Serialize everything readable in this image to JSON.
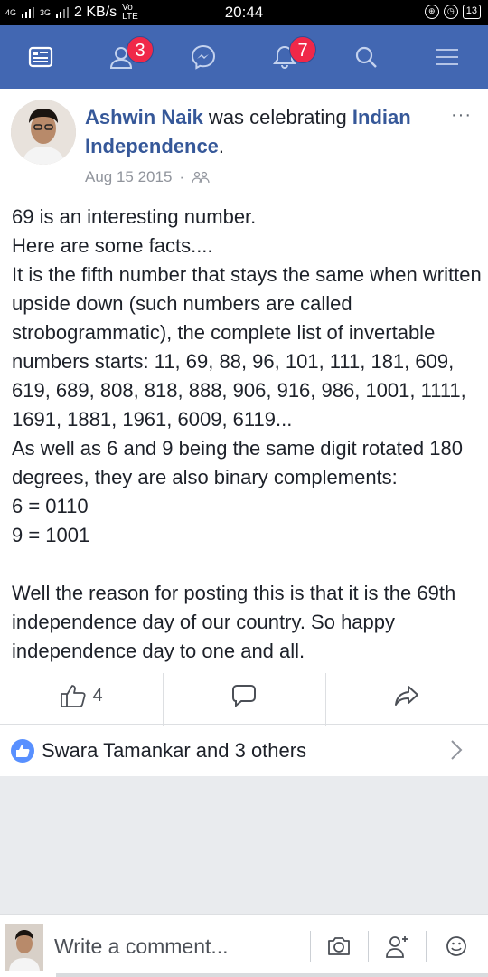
{
  "status_bar": {
    "network_label": "4G",
    "network2_label": "3G",
    "speed": "2 KB/s",
    "volte": "Vo LTE",
    "time": "20:44",
    "battery": "13"
  },
  "navbar": {
    "color": "#4267b2",
    "items": [
      {
        "icon": "news-feed-icon"
      },
      {
        "icon": "friend-requests-icon",
        "badge": "3"
      },
      {
        "icon": "messenger-icon"
      },
      {
        "icon": "notifications-icon",
        "badge": "7"
      },
      {
        "icon": "search-icon"
      },
      {
        "icon": "menu-icon"
      }
    ]
  },
  "post": {
    "author": "Ashwin Naik",
    "action_text": " was celebrating ",
    "event": "Indian Independence",
    "event_suffix": ".",
    "date": "Aug 15 2015",
    "separator": "·",
    "audience_icon": "friends-icon",
    "body": "69 is an interesting number.\nHere are some facts....\nIt is the fifth number that stays the same when written upside down (such numbers are called strobogrammatic), the complete list of invertable numbers starts: 11, 69, 88, 96, 101, 111, 181, 609, 619, 689, 808, 818, 888, 906, 916, 986, 1001, 1111, 1691, 1881, 1961, 6009, 6119...\nAs well as 6 and 9 being the same digit rotated 180 degrees, they are also binary complements:\n6 = 0110\n9 = 1001\n\nWell the reason for posting this is that it is the 69th independence day of our country. So happy independence day to one and all.",
    "like_count": "4",
    "reactions_text": "Swara Tamankar and 3 others"
  },
  "composer": {
    "placeholder": "Write a comment..."
  }
}
